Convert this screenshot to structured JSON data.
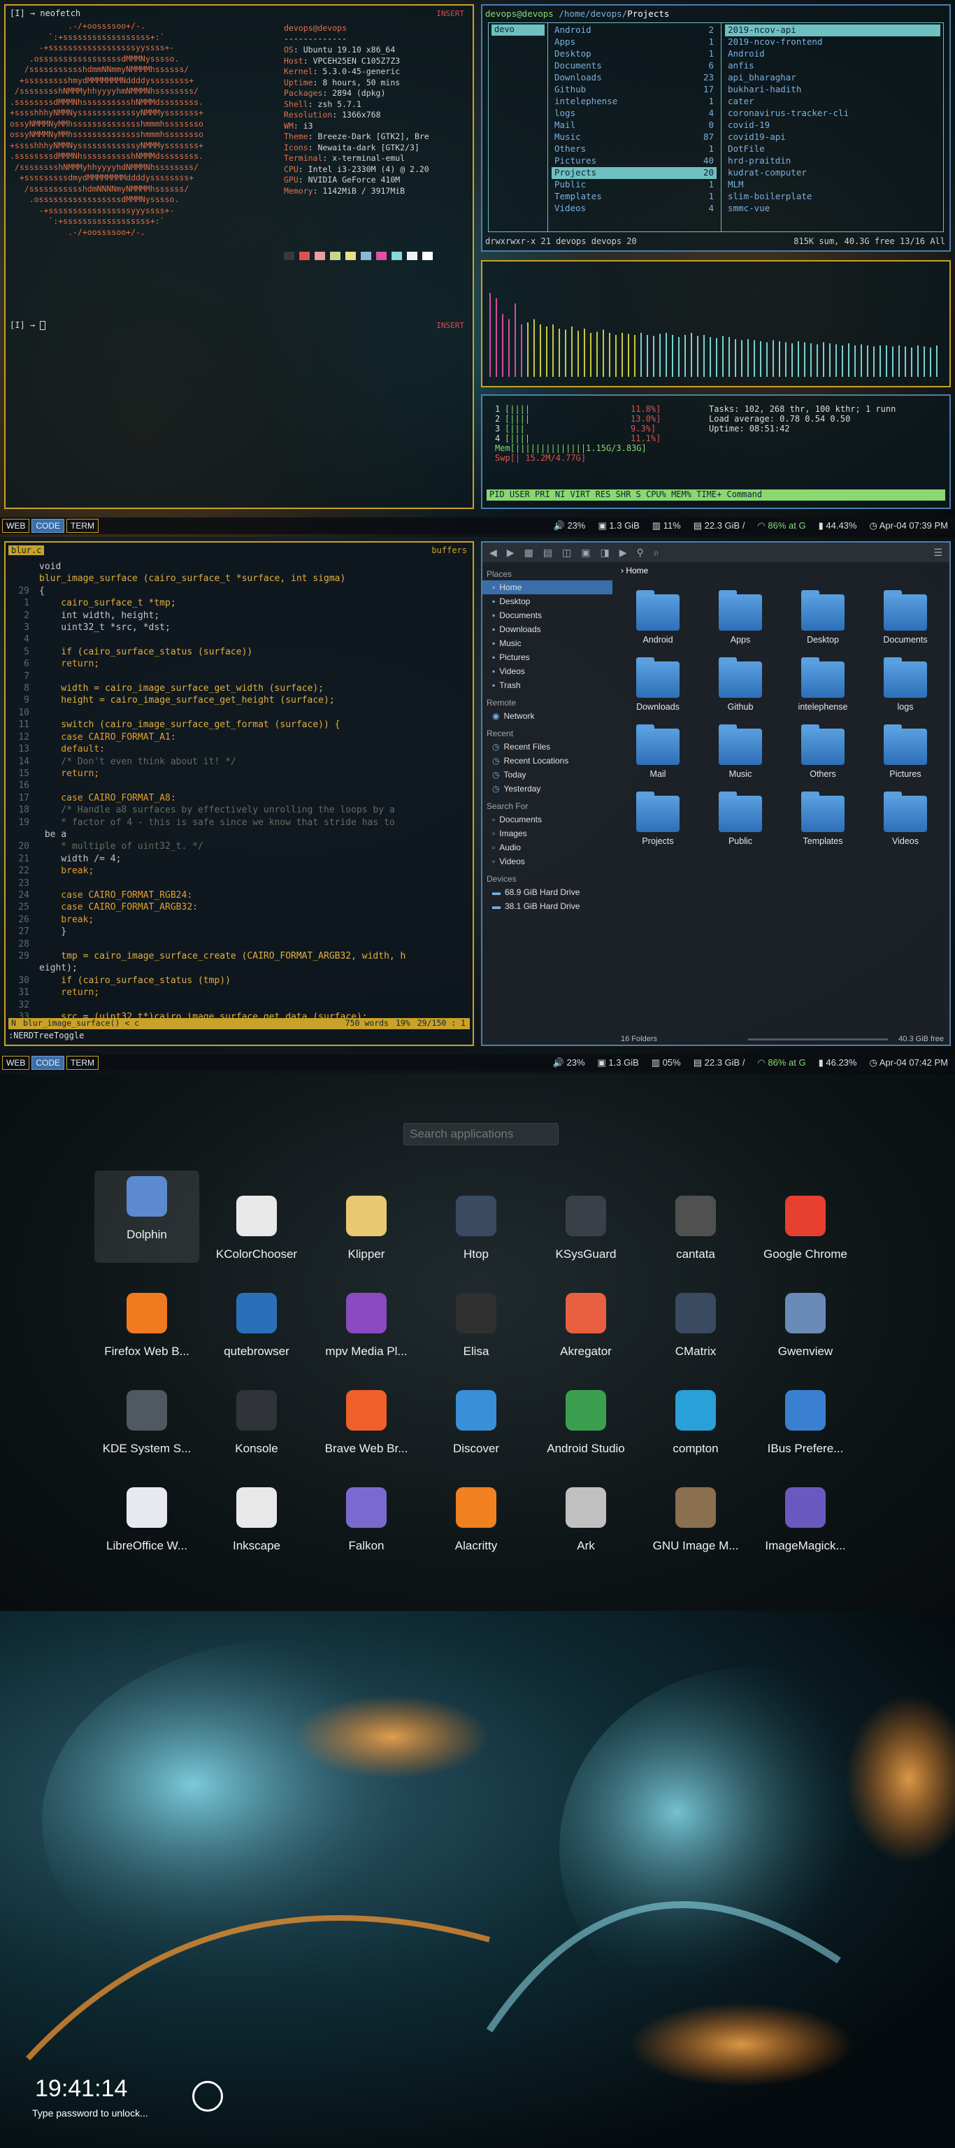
{
  "s1": {
    "terminal": {
      "prompt1": "[I] → neofetch",
      "prompt2": "[I] → ",
      "mode_label": "INSERT",
      "ascii_art": "            .-/+oossssoo+/-.\n        `:+ssssssssssssssssss+:`\n      -+ssssssssssssssssssyyssss+-\n    .osssssssssssssssssdMMMNysssso.\n   /ssssssssssshdmmNNmmyNMMMMhssssss/\n  +ssssssssshmydMMMMMMMNddddyssssssss+\n /sssssssshNMMMyhhyyyyhmNMMMNhssssssss/\n.ssssssssdMMMNhsssssssssshNMMMdssssssss.\n+sssshhhyNMMNyssssssssssssyNMMMysssssss+\nossyNMMMNyMMhsssssssssssssshmmmhssssssso\nossyNMMMNyMMhsssssssssssssshmmmhssssssso\n+sssshhhyNMMNyssssssssssssyNMMMysssssss+\n.ssssssssdMMMNhsssssssssshNMMMdssssssss.\n /sssssssshNMMMyhhyyyyhdNMMMNhssssssss/\n  +sssssssssdmydMMMMMMMMddddyssssssss+\n   /ssssssssssshdmNNNNmyNMMMMhssssss/\n    .osssssssssssssssssdMMMNysssso.\n      -+sssssssssssssssssyyyssss+-\n        `:+ssssssssssssssssss+:`\n            .-/+oossssoo+/-.",
      "user_host": "devops@devops",
      "separator": "-------------",
      "info": [
        {
          "k": "OS",
          "v": "Ubuntu 19.10 x86_64"
        },
        {
          "k": "Host",
          "v": "VPCEH25EN C105Z7Z3"
        },
        {
          "k": "Kernel",
          "v": "5.3.0-45-generic"
        },
        {
          "k": "Uptime",
          "v": "8 hours, 50 mins"
        },
        {
          "k": "Packages",
          "v": "2894 (dpkg)"
        },
        {
          "k": "Shell",
          "v": "zsh 5.7.1"
        },
        {
          "k": "Resolution",
          "v": "1366x768"
        },
        {
          "k": "WM",
          "v": "i3"
        },
        {
          "k": "Theme",
          "v": "Breeze-Dark [GTK2], Bre"
        },
        {
          "k": "Icons",
          "v": "Newaita-dark [GTK2/3]"
        },
        {
          "k": "Terminal",
          "v": "x-terminal-emul"
        },
        {
          "k": "CPU",
          "v": "Intel i3-2330M (4) @ 2.20"
        },
        {
          "k": "GPU",
          "v": "NVIDIA GeForce 410M"
        },
        {
          "k": "Memory",
          "v": "1142MiB / 3917MiB"
        }
      ],
      "swatches": [
        "#3a3a3a",
        "#e05050",
        "#e8a0a0",
        "#c8d88a",
        "#e8e08a",
        "#8ab8d8",
        "#e050a0",
        "#8ad8d8",
        "#f0f0f0",
        "#ffffff"
      ]
    },
    "ranger": {
      "path_user": "devops@devops",
      "path_dir": " /home/devops/",
      "path_cur": "Projects",
      "col1": [
        "devo"
      ],
      "col2": [
        {
          "n": "Android",
          "c": "2"
        },
        {
          "n": "Apps",
          "c": "1"
        },
        {
          "n": "Desktop",
          "c": "1"
        },
        {
          "n": "Documents",
          "c": "6"
        },
        {
          "n": "Downloads",
          "c": "23"
        },
        {
          "n": "Github",
          "c": "17"
        },
        {
          "n": "intelephense",
          "c": "1"
        },
        {
          "n": "logs",
          "c": "4"
        },
        {
          "n": "Mail",
          "c": "0"
        },
        {
          "n": "Music",
          "c": "87"
        },
        {
          "n": "Others",
          "c": "1"
        },
        {
          "n": "Pictures",
          "c": "40"
        },
        {
          "n": "Projects",
          "c": "20"
        },
        {
          "n": "Public",
          "c": "1"
        },
        {
          "n": "Templates",
          "c": "1"
        },
        {
          "n": "Videos",
          "c": "4"
        }
      ],
      "col3": [
        "2019-ncov-api",
        "2019-ncov-frontend",
        "Android",
        "anfis",
        "api_bharaghar",
        "bukhari-hadith",
        "cater",
        "coronavirus-tracker-cli",
        "covid-19",
        "covid19-api",
        "DotFile",
        "hrd-praitdin",
        "kudrat-computer",
        "MLM",
        "slim-boilerplate",
        "smmc-vue"
      ],
      "status_left": "drwxrwxr-x 21 devops devops 20",
      "status_right": "815K sum, 40.3G free  13/16   All"
    },
    "graph_heights": [
      0.8,
      0.75,
      0.6,
      0.55,
      0.7,
      0.5,
      0.52,
      0.55,
      0.5,
      0.48,
      0.5,
      0.46,
      0.45,
      0.48,
      0.44,
      0.46,
      0.42,
      0.43,
      0.45,
      0.42,
      0.4,
      0.42,
      0.41,
      0.4,
      0.42,
      0.4,
      0.39,
      0.41,
      0.42,
      0.4,
      0.38,
      0.4,
      0.42,
      0.39,
      0.4,
      0.38,
      0.37,
      0.39,
      0.38,
      0.36,
      0.35,
      0.36,
      0.35,
      0.34,
      0.33,
      0.35,
      0.34,
      0.33,
      0.32,
      0.34,
      0.33,
      0.32,
      0.31,
      0.33,
      0.32,
      0.31,
      0.3,
      0.32,
      0.3,
      0.31,
      0.3,
      0.29,
      0.3,
      0.3,
      0.29,
      0.3,
      0.29,
      0.28,
      0.3,
      0.29,
      0.28,
      0.3
    ],
    "htop": {
      "cpus": [
        {
          "n": "1",
          "bar": "[||||",
          "pct": "11.8%]"
        },
        {
          "n": "2",
          "bar": "[||||",
          "pct": "13.0%]"
        },
        {
          "n": "3",
          "bar": "[|||",
          "pct": "9.3%]"
        },
        {
          "n": "4",
          "bar": "[||||",
          "pct": "11.1%]"
        }
      ],
      "mem": "Mem[||||||||||||||1.15G/3.83G]",
      "swp": "Swp[|                15.2M/4.77G]",
      "tasks": "Tasks: 102, 268 thr, 100 kthr; 1 runn",
      "load": "Load average: 0.78 0.54 0.50",
      "uptime": "Uptime: 08:51:42",
      "header": "PID USER      PRI  NI  VIRT   RES   SHR S  CPU%  MEM%   TIME+  Command"
    },
    "bar": {
      "ws": [
        "WEB",
        "CODE",
        "TERM"
      ],
      "vol": "23%",
      "ram": "1.3 GiB",
      "cpu": "11%",
      "disk": "22.3 GiB /",
      "wifi": "86% at G",
      "bat": "44.43%",
      "date": "Apr-04 07:39 PM"
    }
  },
  "s2": {
    "vim": {
      "tab": "blur.c",
      "buffers_label": "buffers",
      "lines": [
        {
          "n": "",
          "t": "void"
        },
        {
          "n": "",
          "t": "blur_image_surface (cairo_surface_t *surface, int sigma)"
        },
        {
          "n": "29",
          "t": "{"
        },
        {
          "n": "1",
          "t": "    cairo_surface_t *tmp;"
        },
        {
          "n": "2",
          "t": "    int width, height;"
        },
        {
          "n": "3",
          "t": "    uint32_t *src, *dst;"
        },
        {
          "n": "4",
          "t": ""
        },
        {
          "n": "5",
          "t": "    if (cairo_surface_status (surface))"
        },
        {
          "n": "6",
          "t": "    return;"
        },
        {
          "n": "7",
          "t": ""
        },
        {
          "n": "8",
          "t": "    width = cairo_image_surface_get_width (surface);"
        },
        {
          "n": "9",
          "t": "    height = cairo_image_surface_get_height (surface);"
        },
        {
          "n": "10",
          "t": ""
        },
        {
          "n": "11",
          "t": "    switch (cairo_image_surface_get_format (surface)) {"
        },
        {
          "n": "12",
          "t": "    case CAIRO_FORMAT_A1:"
        },
        {
          "n": "13",
          "t": "    default:"
        },
        {
          "n": "14",
          "t": "    /* Don't even think about it! */"
        },
        {
          "n": "15",
          "t": "    return;"
        },
        {
          "n": "16",
          "t": ""
        },
        {
          "n": "17",
          "t": "    case CAIRO_FORMAT_A8:"
        },
        {
          "n": "18",
          "t": "    /* Handle a8 surfaces by effectively unrolling the loops by a"
        },
        {
          "n": "19",
          "t": "    * factor of 4 - this is safe since we know that stride has to"
        },
        {
          "n": "",
          "t": " be a"
        },
        {
          "n": "20",
          "t": "    * multiple of uint32_t. */"
        },
        {
          "n": "21",
          "t": "    width /= 4;"
        },
        {
          "n": "22",
          "t": "    break;"
        },
        {
          "n": "23",
          "t": ""
        },
        {
          "n": "24",
          "t": "    case CAIRO_FORMAT_RGB24:"
        },
        {
          "n": "25",
          "t": "    case CAIRO_FORMAT_ARGB32:"
        },
        {
          "n": "26",
          "t": "    break;"
        },
        {
          "n": "27",
          "t": "    }"
        },
        {
          "n": "28",
          "t": ""
        },
        {
          "n": "29",
          "t": "    tmp = cairo_image_surface_create (CAIRO_FORMAT_ARGB32, width, h"
        },
        {
          "n": "",
          "t": "eight);"
        },
        {
          "n": "30",
          "t": "    if (cairo_surface_status (tmp))"
        },
        {
          "n": "31",
          "t": "    return;"
        },
        {
          "n": "32",
          "t": ""
        },
        {
          "n": "33",
          "t": "    src = (uint32_t*)cairo_image_surface_get_data (surface);"
        }
      ],
      "status_mode": "N",
      "status_fn": "blur_image_surface() < c",
      "status_words": "750 words",
      "status_pct": "19%",
      "status_pos": "29/150  :  1",
      "cmdline": ":NERDTreeToggle"
    },
    "dolphin": {
      "breadcrumb": "Home",
      "places_hd": "Places",
      "places": [
        "Home",
        "Desktop",
        "Documents",
        "Downloads",
        "Music",
        "Pictures",
        "Videos",
        "Trash"
      ],
      "remote_hd": "Remote",
      "remote": [
        "Network"
      ],
      "recent_hd": "Recent",
      "recent": [
        "Recent Files",
        "Recent Locations",
        "Today",
        "Yesterday"
      ],
      "search_hd": "Search For",
      "search": [
        "Documents",
        "Images",
        "Audio",
        "Videos"
      ],
      "devices_hd": "Devices",
      "devices": [
        "68.9 GiB Hard Drive",
        "38.1 GiB Hard Drive"
      ],
      "folders": [
        "Android",
        "Apps",
        "Desktop",
        "Documents",
        "Downloads",
        "Github",
        "intelephense",
        "logs",
        "Mail",
        "Music",
        "Others",
        "Pictures",
        "Projects",
        "Public",
        "Templates",
        "Videos"
      ],
      "status_count": "16 Folders",
      "status_free": "40.3 GiB free"
    },
    "bar": {
      "ws": [
        "WEB",
        "CODE",
        "TERM"
      ],
      "vol": "23%",
      "ram": "1.3 GiB",
      "cpu": "05%",
      "disk": "22.3 GiB /",
      "wifi": "86% at G",
      "bat": "46.23%",
      "date": "Apr-04 07:42 PM"
    }
  },
  "s3": {
    "search_placeholder": "Search applications",
    "apps": [
      {
        "name": "Dolphin",
        "color": "#5b8ad0"
      },
      {
        "name": "KColorChooser",
        "color": "#e8e8e8"
      },
      {
        "name": "Klipper",
        "color": "#e8c870"
      },
      {
        "name": "Htop",
        "color": "#3a4a60"
      },
      {
        "name": "KSysGuard",
        "color": "#3a4048"
      },
      {
        "name": "cantata",
        "color": "#505050"
      },
      {
        "name": "Google Chrome",
        "color": "#e84030"
      },
      {
        "name": "Firefox Web B...",
        "color": "#f07a20"
      },
      {
        "name": "qutebrowser",
        "color": "#2a70b8"
      },
      {
        "name": "mpv Media Pl...",
        "color": "#8a4ac0"
      },
      {
        "name": "Elisa",
        "color": "#303030"
      },
      {
        "name": "Akregator",
        "color": "#e86040"
      },
      {
        "name": "CMatrix",
        "color": "#3a4a60"
      },
      {
        "name": "Gwenview",
        "color": "#6a8ab8"
      },
      {
        "name": "KDE System S...",
        "color": "#505860"
      },
      {
        "name": "Konsole",
        "color": "#303438"
      },
      {
        "name": "Brave Web Br...",
        "color": "#f0602a"
      },
      {
        "name": "Discover",
        "color": "#3a90d8"
      },
      {
        "name": "Android Studio",
        "color": "#3aa050"
      },
      {
        "name": "compton",
        "color": "#2aa0d8"
      },
      {
        "name": "IBus Prefere...",
        "color": "#3a80d0"
      },
      {
        "name": "LibreOffice W...",
        "color": "#e8e8f0"
      },
      {
        "name": "Inkscape",
        "color": "#e8e8e8"
      },
      {
        "name": "Falkon",
        "color": "#7a6ad0"
      },
      {
        "name": "Alacritty",
        "color": "#f08020"
      },
      {
        "name": "Ark",
        "color": "#c0c0c0"
      },
      {
        "name": "GNU Image M...",
        "color": "#8a7050"
      },
      {
        "name": "ImageMagick...",
        "color": "#6a5ac0"
      }
    ]
  },
  "s4": {
    "time": "19:41:14",
    "prompt": "Type password to unlock..."
  }
}
